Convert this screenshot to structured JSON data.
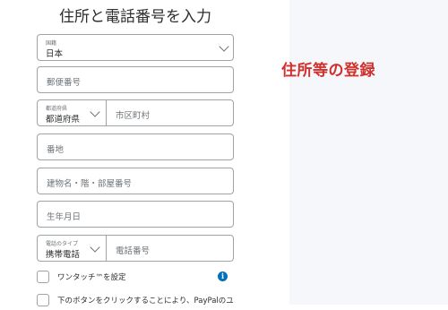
{
  "page": {
    "title": "住所と電話番号を入力"
  },
  "annotation": {
    "text": "住所等の登録"
  },
  "form": {
    "country": {
      "label": "国籍",
      "value": "日本"
    },
    "postal_code": {
      "placeholder": "郵便番号"
    },
    "prefecture": {
      "label": "都道府県",
      "value": "都道府県"
    },
    "city": {
      "placeholder": "市区町村"
    },
    "street": {
      "placeholder": "番地"
    },
    "building": {
      "placeholder": "建物名・階・部屋番号"
    },
    "birthdate": {
      "placeholder": "生年月日"
    },
    "phone_type": {
      "label": "電話のタイプ",
      "value": "携帯電話"
    },
    "phone_number": {
      "placeholder": "電話番号"
    },
    "one_touch": {
      "label": "ワンタッチ™を設定"
    },
    "consent": {
      "label": "下のボタンをクリックすることにより、PayPalのユ"
    }
  },
  "icons": {
    "chevron": "chevron-down-icon",
    "info": "info-icon"
  },
  "colors": {
    "annotation": "#d0312d",
    "info": "#0070ba",
    "border": "#9da3a6",
    "panel": "#f5f7fa"
  }
}
